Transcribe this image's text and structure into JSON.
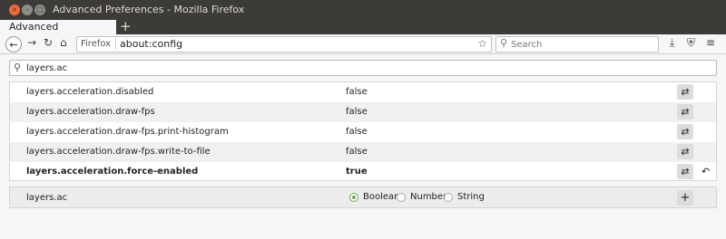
{
  "window": {
    "title": "Advanced Preferences - Mozilla Firefox",
    "close_glyph": "×",
    "min_glyph": "–",
    "max_glyph": "□"
  },
  "tab": {
    "label": "Advanced Preferences",
    "new_tab_glyph": "+"
  },
  "nav": {
    "back_glyph": "←",
    "forward_glyph": "→",
    "reload_glyph": "↻",
    "home_glyph": "⌂",
    "identity_label": "Firefox",
    "url": "about:config",
    "bookmark_glyph": "☆",
    "search_placeholder": "Search",
    "download_glyph": "⤓",
    "shield_glyph": "⛨",
    "menu_glyph": "≡"
  },
  "filter": {
    "value": "layers.ac"
  },
  "prefs": [
    {
      "name": "layers.acceleration.disabled",
      "value": "false",
      "modified": false
    },
    {
      "name": "layers.acceleration.draw-fps",
      "value": "false",
      "modified": false
    },
    {
      "name": "layers.acceleration.draw-fps.print-histogram",
      "value": "false",
      "modified": false
    },
    {
      "name": "layers.acceleration.draw-fps.write-to-file",
      "value": "false",
      "modified": false
    },
    {
      "name": "layers.acceleration.force-enabled",
      "value": "true",
      "modified": true
    }
  ],
  "toggle_glyph": "⇄",
  "reset_glyph": "↶",
  "add": {
    "name": "layers.ac",
    "types": [
      {
        "label": "Boolean",
        "selected": true
      },
      {
        "label": "Number",
        "selected": false
      },
      {
        "label": "String",
        "selected": false
      }
    ],
    "add_glyph": "+"
  },
  "colors": {
    "accent": "#6aa84f",
    "titlebar": "#3c3b37",
    "close": "#f06a3b"
  }
}
